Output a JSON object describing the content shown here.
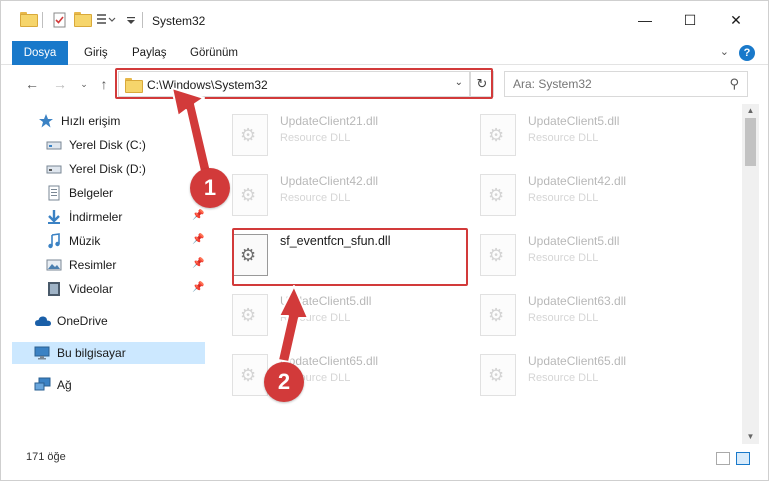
{
  "window": {
    "title": "System32",
    "minimize": "—",
    "maximize": "☐",
    "close": "✕"
  },
  "ribbon": {
    "tabs": [
      "Dosya",
      "Giriş",
      "Paylaş",
      "Görünüm"
    ]
  },
  "address": {
    "path": "C:\\Windows\\System32",
    "search_placeholder": "Ara: System32"
  },
  "sidebar": {
    "items": [
      {
        "label": "Hızlı erişim",
        "icon": "star-icon"
      },
      {
        "label": "Yerel Disk (C:)",
        "icon": "drive-icon"
      },
      {
        "label": "Yerel Disk (D:)",
        "icon": "drive-icon"
      },
      {
        "label": "Belgeler",
        "icon": "documents-icon"
      },
      {
        "label": "İndirmeler",
        "icon": "download-icon"
      },
      {
        "label": "Müzik",
        "icon": "music-icon"
      },
      {
        "label": "Resimler",
        "icon": "pictures-icon"
      },
      {
        "label": "Videolar",
        "icon": "videos-icon"
      },
      {
        "label": "OneDrive",
        "icon": "cloud-icon"
      },
      {
        "label": "Bu bilgisayar",
        "icon": "computer-icon"
      },
      {
        "label": "Ağ",
        "icon": "network-icon"
      }
    ],
    "selected": "Bu bilgisayar"
  },
  "files": {
    "left_column": [
      {
        "name": "UpdateClient21.dll",
        "type": "Resource DLL"
      },
      {
        "name": "UpdateClient42.dll",
        "type": "Resource DLL"
      },
      {
        "name": "sf_eventfcn_sfun.dll",
        "type": "",
        "highlighted": true
      },
      {
        "name": "UpdateClient5.dll",
        "type": "Resource DLL"
      },
      {
        "name": "UpdateClient65.dll",
        "type": "Resource DLL"
      }
    ],
    "right_column": [
      {
        "name": "UpdateClient5.dll",
        "type": "Resource DLL"
      },
      {
        "name": "UpdateClient42.dll",
        "type": "Resource DLL"
      },
      {
        "name": "UpdateClient5.dll",
        "type": "Resource DLL"
      },
      {
        "name": "UpdateClient63.dll",
        "type": "Resource DLL"
      },
      {
        "name": "UpdateClient65.dll",
        "type": "Resource DLL"
      }
    ]
  },
  "status": {
    "item_count": "171 öğe"
  },
  "annotations": {
    "step1": "1",
    "step2": "2",
    "color": "#d23a3a"
  },
  "colors": {
    "accent": "#1979ca",
    "selection": "#cce8ff",
    "annotation_red": "#d23a3a"
  }
}
